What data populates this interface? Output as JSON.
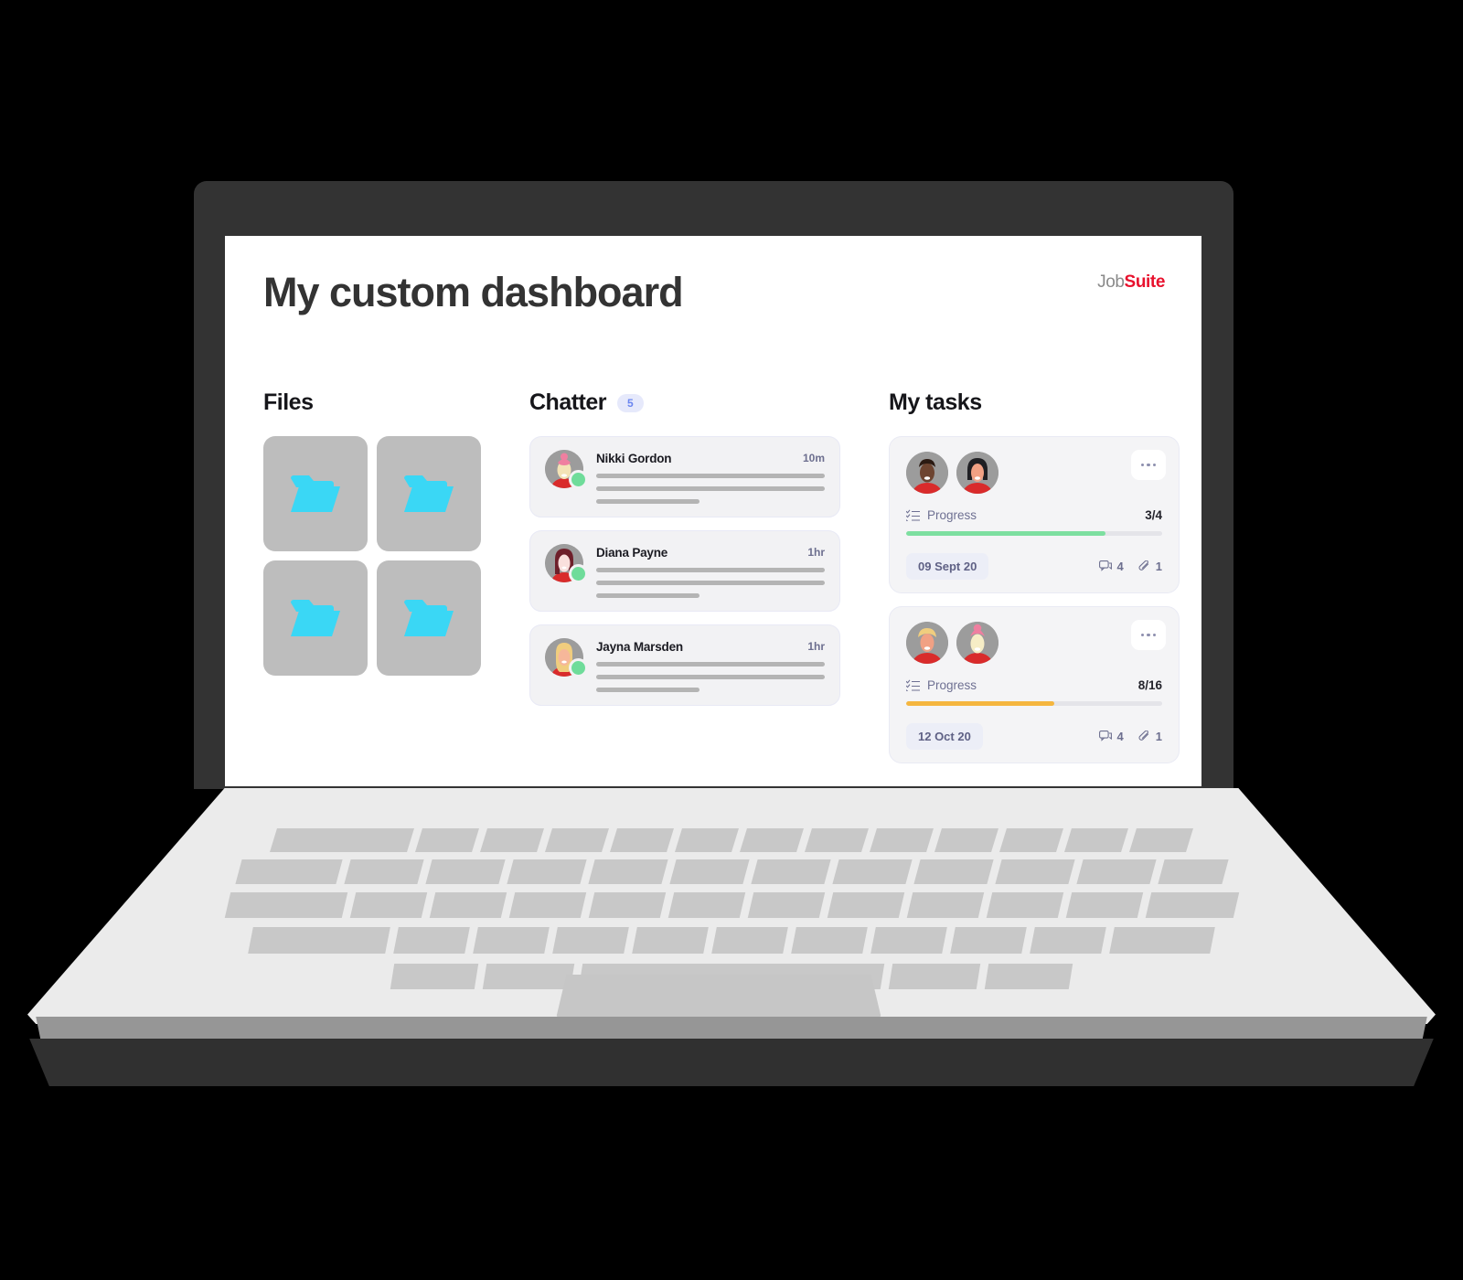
{
  "device": {
    "type": "laptop-mockup"
  },
  "page": {
    "title": "My custom dashboard",
    "logo": {
      "part1": "Job",
      "part2": "Suite",
      "part1_color": "#8a8a8a",
      "part2_color": "#e8112d"
    }
  },
  "files": {
    "title": "Files",
    "items": [
      {
        "icon": "folder-icon"
      },
      {
        "icon": "folder-icon"
      },
      {
        "icon": "folder-icon"
      },
      {
        "icon": "folder-icon"
      }
    ]
  },
  "chatter": {
    "title": "Chatter",
    "badge": "5",
    "messages": [
      {
        "name": "Nikki Gordon",
        "time": "10m",
        "status": "online"
      },
      {
        "name": "Diana Payne",
        "time": "1hr",
        "status": "online"
      },
      {
        "name": "Jayna Marsden",
        "time": "1hr",
        "status": "online"
      }
    ]
  },
  "tasks": {
    "title": "My tasks",
    "items": [
      {
        "progress_label": "Progress",
        "progress_count": "3/4",
        "progress_pct": 78,
        "progress_color": "#7ddfa0",
        "date": "09 Sept 20",
        "comments": "4",
        "attachments": "1",
        "menu": "more-options"
      },
      {
        "progress_label": "Progress",
        "progress_count": "8/16",
        "progress_pct": 58,
        "progress_color": "#f5b63f",
        "date": "12 Oct 20",
        "comments": "4",
        "attachments": "1",
        "menu": "more-options"
      }
    ]
  },
  "colors": {
    "bezel": "#333333",
    "deck": "#ebebeb",
    "key": "#c8c8c8",
    "folder": "#3ad7f5",
    "tile": "#bdbdbd",
    "badge_bg": "#e6e9fb",
    "badge_fg": "#6b86f0"
  }
}
